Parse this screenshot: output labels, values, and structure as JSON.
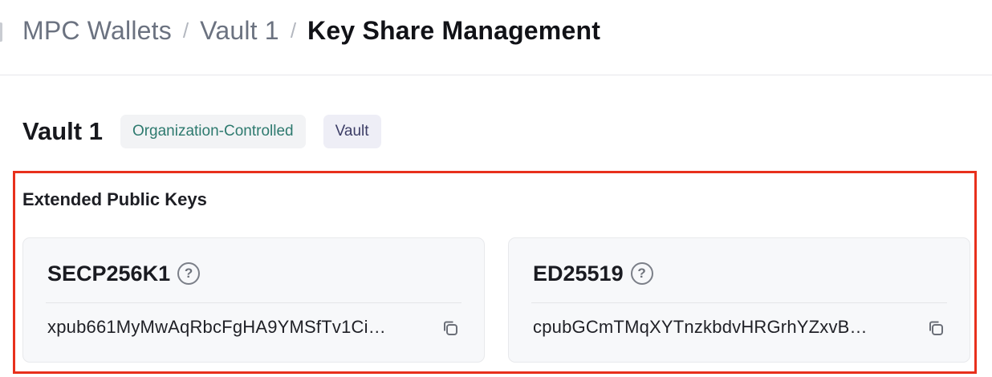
{
  "breadcrumb": {
    "items": [
      {
        "label": "MPC Wallets"
      },
      {
        "label": "Vault 1"
      },
      {
        "label": "Key Share Management"
      }
    ],
    "separator": "/"
  },
  "vault": {
    "title": "Vault 1",
    "badges": [
      {
        "label": "Organization-Controlled",
        "color": "#2e7a6f"
      },
      {
        "label": "Vault",
        "color": "#3c3d66"
      }
    ]
  },
  "extended_keys": {
    "title": "Extended Public Keys",
    "highlight_color": "#e8301c",
    "cards": [
      {
        "name": "SECP256K1",
        "help_icon": "question-circle-icon",
        "value": "xpub661MyMwAqRbcFgHA9YMSfTv1Ci…",
        "copy_icon": "copy-icon"
      },
      {
        "name": "ED25519",
        "help_icon": "question-circle-icon",
        "value": "cpubGCmTMqXYTnzkbdvHRGrhYZxvB…",
        "copy_icon": "copy-icon"
      }
    ]
  }
}
